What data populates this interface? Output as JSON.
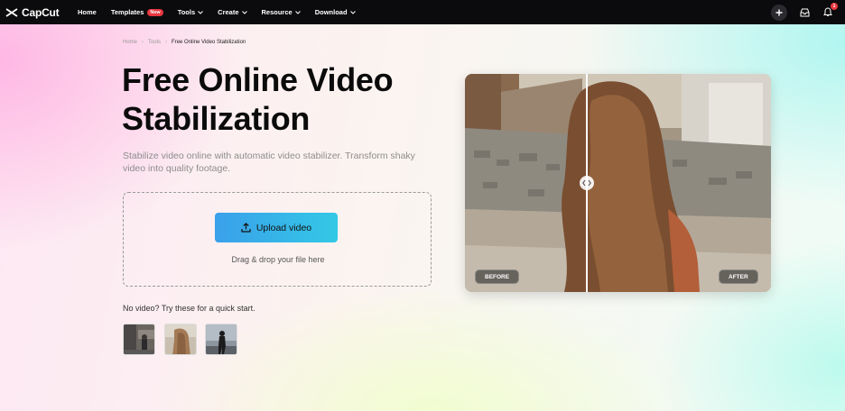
{
  "nav": {
    "brand": "CapCut",
    "items": [
      {
        "label": "Home",
        "dropdown": false
      },
      {
        "label": "Templates",
        "badge": "New",
        "dropdown": false
      },
      {
        "label": "Tools",
        "dropdown": true
      },
      {
        "label": "Create",
        "dropdown": true
      },
      {
        "label": "Resource",
        "dropdown": true
      },
      {
        "label": "Download",
        "dropdown": true
      }
    ],
    "notification_count": "1",
    "icons": [
      "plus-icon",
      "inbox-icon",
      "bell-icon"
    ]
  },
  "breadcrumb": [
    "Home",
    "Tools",
    "Free Online Video Stabilization"
  ],
  "hero": {
    "title": "Free Online Video Stabilization",
    "subtitle": "Stabilize video online with automatic video stabilizer. Transform shaky video into quality footage."
  },
  "upload": {
    "button_label": "Upload video",
    "drag_text": "Drag & drop your file here"
  },
  "samples": {
    "label": "No video? Try these for a quick start.",
    "count": 3
  },
  "compare": {
    "before_label": "BEFORE",
    "after_label": "AFTER"
  },
  "colors": {
    "nav_bg": "#0b0b0d",
    "accent_start": "#3aa0ea",
    "accent_end": "#33c8e6",
    "badge": "#e8363f"
  }
}
